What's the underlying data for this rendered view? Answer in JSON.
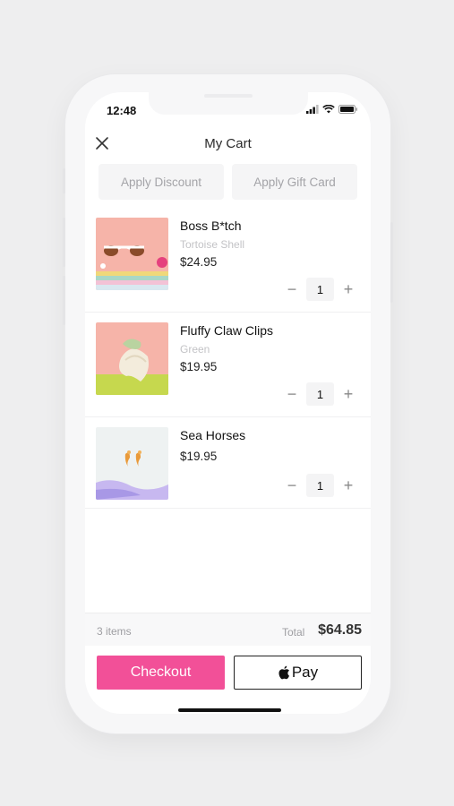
{
  "status_bar": {
    "time": "12:48"
  },
  "header": {
    "title": "My Cart",
    "close_icon": "close-icon"
  },
  "promos": {
    "discount_label": "Apply Discount",
    "gift_card_label": "Apply Gift Card"
  },
  "cart": {
    "items": [
      {
        "name": "Boss B*tch",
        "variant": "Tortoise Shell",
        "price": "$24.95",
        "quantity": "1",
        "thumb_icon": "sunglasses-thumbnail"
      },
      {
        "name": "Fluffy Claw Clips",
        "variant": "Green",
        "price": "$19.95",
        "quantity": "1",
        "thumb_icon": "claw-clips-thumbnail"
      },
      {
        "name": "Sea Horses",
        "variant": "",
        "price": "$19.95",
        "quantity": "1",
        "thumb_icon": "seahorse-earrings-thumbnail"
      }
    ]
  },
  "summary": {
    "item_count": "3 items",
    "total_label": "Total",
    "total_value": "$64.85"
  },
  "actions": {
    "checkout_label": "Checkout",
    "applepay_label": "Pay"
  },
  "colors": {
    "accent": "#f25098",
    "background": "#eeeeef"
  }
}
